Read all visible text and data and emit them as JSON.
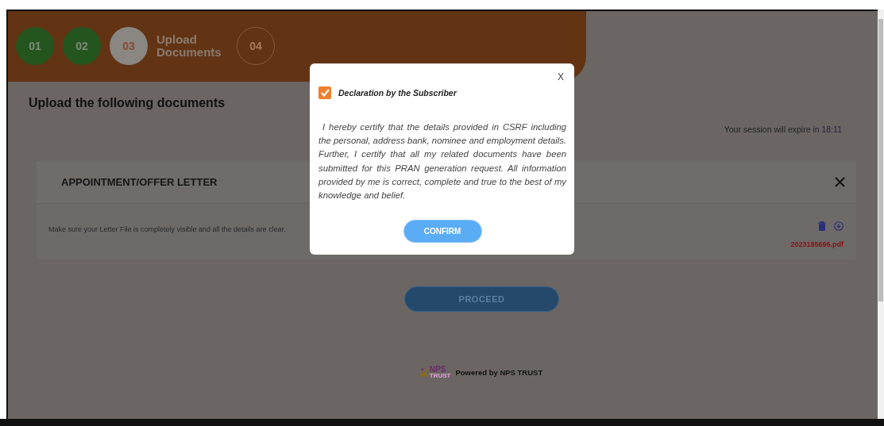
{
  "steps": [
    {
      "number": "01",
      "completed": true,
      "selected": false
    },
    {
      "number": "02",
      "completed": true,
      "selected": false
    },
    {
      "number": "03",
      "completed": false,
      "selected": true,
      "label": "Upload Documents"
    },
    {
      "number": "04",
      "completed": false,
      "selected": false
    }
  ],
  "heading": "Upload the following documents",
  "session": {
    "text": "Your session will expire",
    "time": "in 18:11"
  },
  "document": {
    "title": "APPOINTMENT/OFFER LETTER",
    "hint": "Make sure your Letter File is completely visible and all the details are clear.",
    "file": "2023185696.pdf"
  },
  "proceed_button": "PROCEED",
  "footer": {
    "logo": "NPS",
    "logo_sub": "TRUST",
    "text": "Powered by NPS TRUST"
  },
  "modal": {
    "close": "X",
    "checked": true,
    "title": "Declaration by the Subscriber",
    "body": " I hereby certify that the details provided in CSRF including the personal, address bank, nominee and employment details. Further, I certify that all my related documents have been submitted for this PRAN generation request. All information provided by me is correct, complete and true to the best of my knowledge and belief.",
    "button": "CONFIRM"
  }
}
